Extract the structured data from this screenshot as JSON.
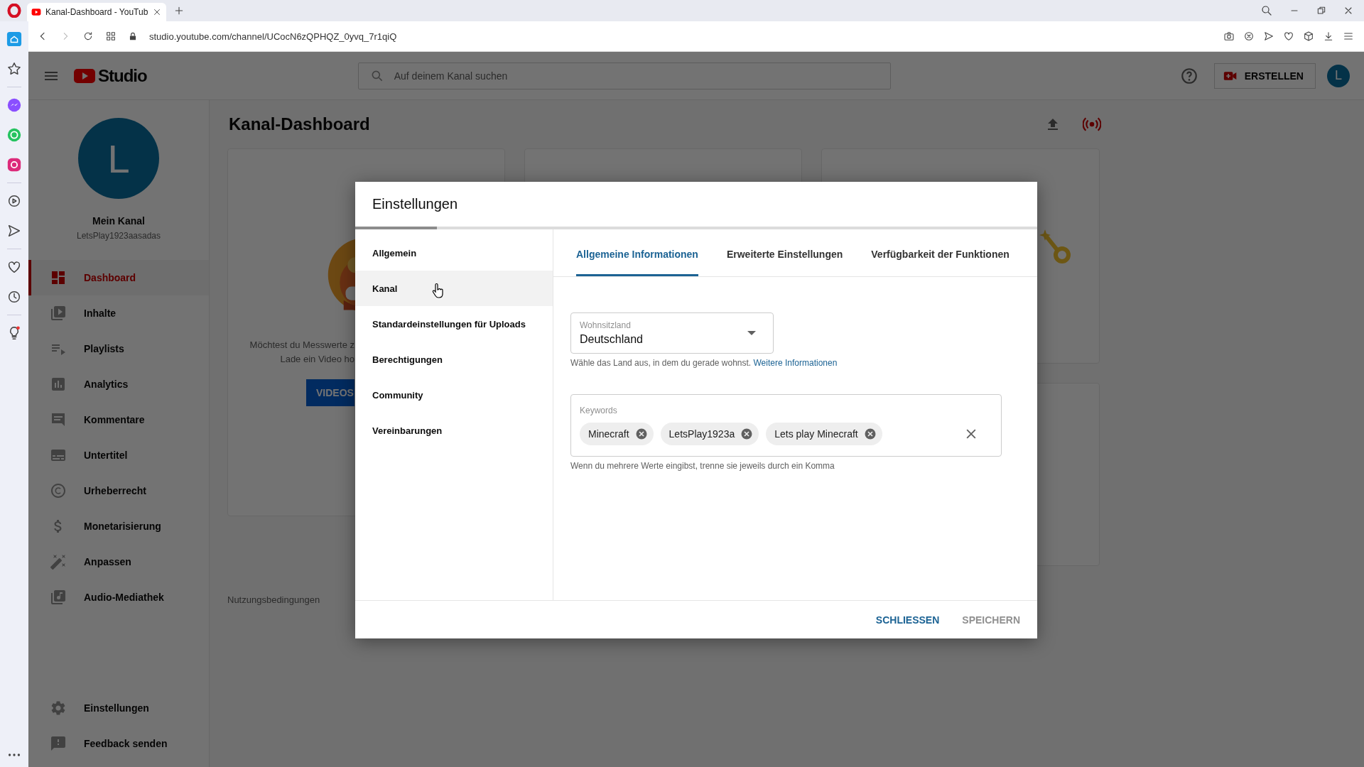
{
  "browser": {
    "tab_title": "Kanal-Dashboard - YouTub",
    "url": "studio.youtube.com/channel/UCocN6zQPHQZ_0yvq_7r1qiQ"
  },
  "header": {
    "logo_text": "Studio",
    "search_placeholder": "Auf deinem Kanal suchen",
    "create_button": "ERSTELLEN",
    "avatar_letter": "L"
  },
  "sidebar": {
    "avatar_letter": "L",
    "channel_name": "Mein Kanal",
    "channel_handle": "LetsPlay1923aasadas",
    "items": [
      {
        "kind": "dashboard",
        "label": "Dashboard",
        "selected": true
      },
      {
        "kind": "content",
        "label": "Inhalte",
        "selected": false
      },
      {
        "kind": "playlists",
        "label": "Playlists",
        "selected": false
      },
      {
        "kind": "analytics",
        "label": "Analytics",
        "selected": false
      },
      {
        "kind": "comments",
        "label": "Kommentare",
        "selected": false
      },
      {
        "kind": "subtitles",
        "label": "Untertitel",
        "selected": false
      },
      {
        "kind": "copyright",
        "label": "Urheberrecht",
        "selected": false
      },
      {
        "kind": "money",
        "label": "Monetarisierung",
        "selected": false
      },
      {
        "kind": "customize",
        "label": "Anpassen",
        "selected": false
      },
      {
        "kind": "audio",
        "label": "Audio-Mediathek",
        "selected": false
      }
    ],
    "bottom_items": [
      {
        "kind": "settings",
        "label": "Einstellungen"
      },
      {
        "kind": "feedback",
        "label": "Feedback senden"
      }
    ]
  },
  "page": {
    "title": "Kanal-Dashboard",
    "card_text": [
      "Möchtest du Messwerte z",
      "Lade ein Video ho"
    ],
    "card_button": "VIDEOS",
    "footer_link": "Nutzungsbedingungen"
  },
  "dialog": {
    "title": "Einstellungen",
    "progress": {
      "level": 0.12
    },
    "nav": [
      {
        "label": "Allgemein",
        "selected": false
      },
      {
        "label": "Kanal",
        "selected": true
      },
      {
        "label": "Standardeinstellungen für Uploads",
        "selected": false
      },
      {
        "label": "Berechtigungen",
        "selected": false
      },
      {
        "label": "Community",
        "selected": false
      },
      {
        "label": "Vereinbarungen",
        "selected": false
      }
    ],
    "tabs": [
      {
        "label": "Allgemeine Informationen",
        "selected": true
      },
      {
        "label": "Erweiterte Einstellungen",
        "selected": false
      },
      {
        "label": "Verfügbarkeit der Funktionen",
        "selected": false
      }
    ],
    "country": {
      "label": "Wohnsitzland",
      "value": "Deutschland"
    },
    "country_hint": "Wähle das Land aus, in dem du gerade wohnst.",
    "country_hint_link": "Weitere Informationen",
    "keywords": {
      "label": "Keywords",
      "chips": [
        "Minecraft",
        "LetsPlay1923a",
        "Lets play Minecraft"
      ]
    },
    "keywords_hint": "Wenn du mehrere Werte eingibst, trenne sie jeweils durch ein Komma",
    "buttons": [
      {
        "kind": "primary",
        "label": "SCHLIESSEN"
      },
      {
        "kind": "disabled",
        "label": "SPEICHERN"
      }
    ]
  }
}
